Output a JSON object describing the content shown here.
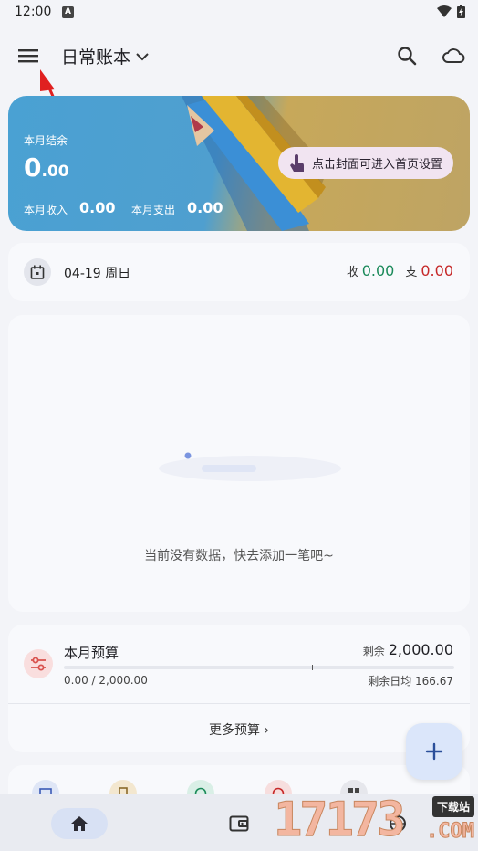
{
  "status": {
    "time": "12:00",
    "notif_letter": "A"
  },
  "header": {
    "book_title": "日常账本"
  },
  "cover": {
    "balance_label": "本月结余",
    "balance_int": "0",
    "balance_dec": ".00",
    "income_label": "本月收入",
    "income_value": "0.00",
    "expense_label": "本月支出",
    "expense_value": "0.00",
    "tip": "点击封面可进入首页设置"
  },
  "day": {
    "date": "04-19 周日",
    "income_label": "收",
    "income_value": "0.00",
    "expense_label": "支",
    "expense_value": "0.00",
    "income_color": "#1b8a5a",
    "expense_color": "#c62828"
  },
  "empty": {
    "message": "当前没有数据，快去添加一笔吧~"
  },
  "budget": {
    "title": "本月预算",
    "remain_label": "剩余",
    "remain_value": "2,000.00",
    "used_text": "0.00 / 2,000.00",
    "daily_text": "剩余日均 166.67",
    "more_label": "更多预算 ›"
  },
  "watermark": {
    "number": "17173",
    "tag": "下载站",
    "com": ".COM"
  },
  "colors": {
    "accent": "#dbe6fa",
    "background": "#f3f4f8"
  }
}
